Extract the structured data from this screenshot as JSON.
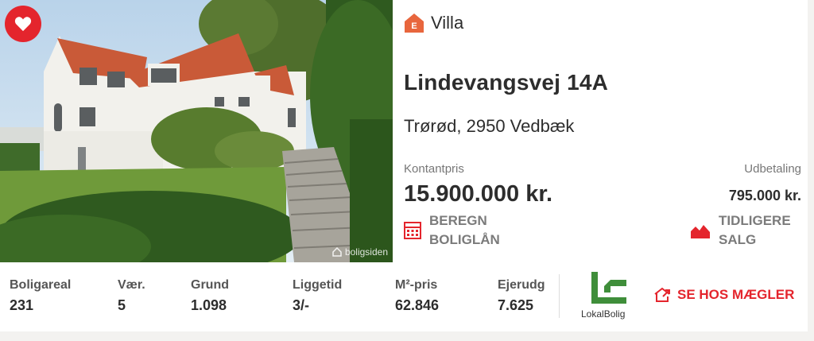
{
  "listing": {
    "favorite_icon": "heart-icon",
    "watermark": "boligsiden",
    "type_badge_letter": "E",
    "type": "Villa",
    "address": "Lindevangsvej 14A",
    "city": "Trørød, 2950 Vedbæk",
    "cash_price_label": "Kontantpris",
    "cash_price": "15.900.000 kr.",
    "down_payment_label": "Udbetaling",
    "down_payment": "795.000 kr.",
    "loan_action": "BEREGN\nBOLIGLÅN",
    "sales_action": "TIDLIGERE\nSALG"
  },
  "stats": [
    {
      "label": "Boligareal",
      "value": "231"
    },
    {
      "label": "Vær.",
      "value": "5"
    },
    {
      "label": "Grund",
      "value": "1.098"
    },
    {
      "label": "Liggetid",
      "value": "3/-"
    },
    {
      "label": "M²-pris",
      "value": "62.846"
    },
    {
      "label": "Ejerudg",
      "value": "7.625"
    }
  ],
  "broker": {
    "name": "LokalBolig",
    "button": "SE HOS MÆGLER"
  },
  "colors": {
    "accent": "#e4252d",
    "type_badge": "#e8663d",
    "broker_green": "#3f8e3a"
  }
}
